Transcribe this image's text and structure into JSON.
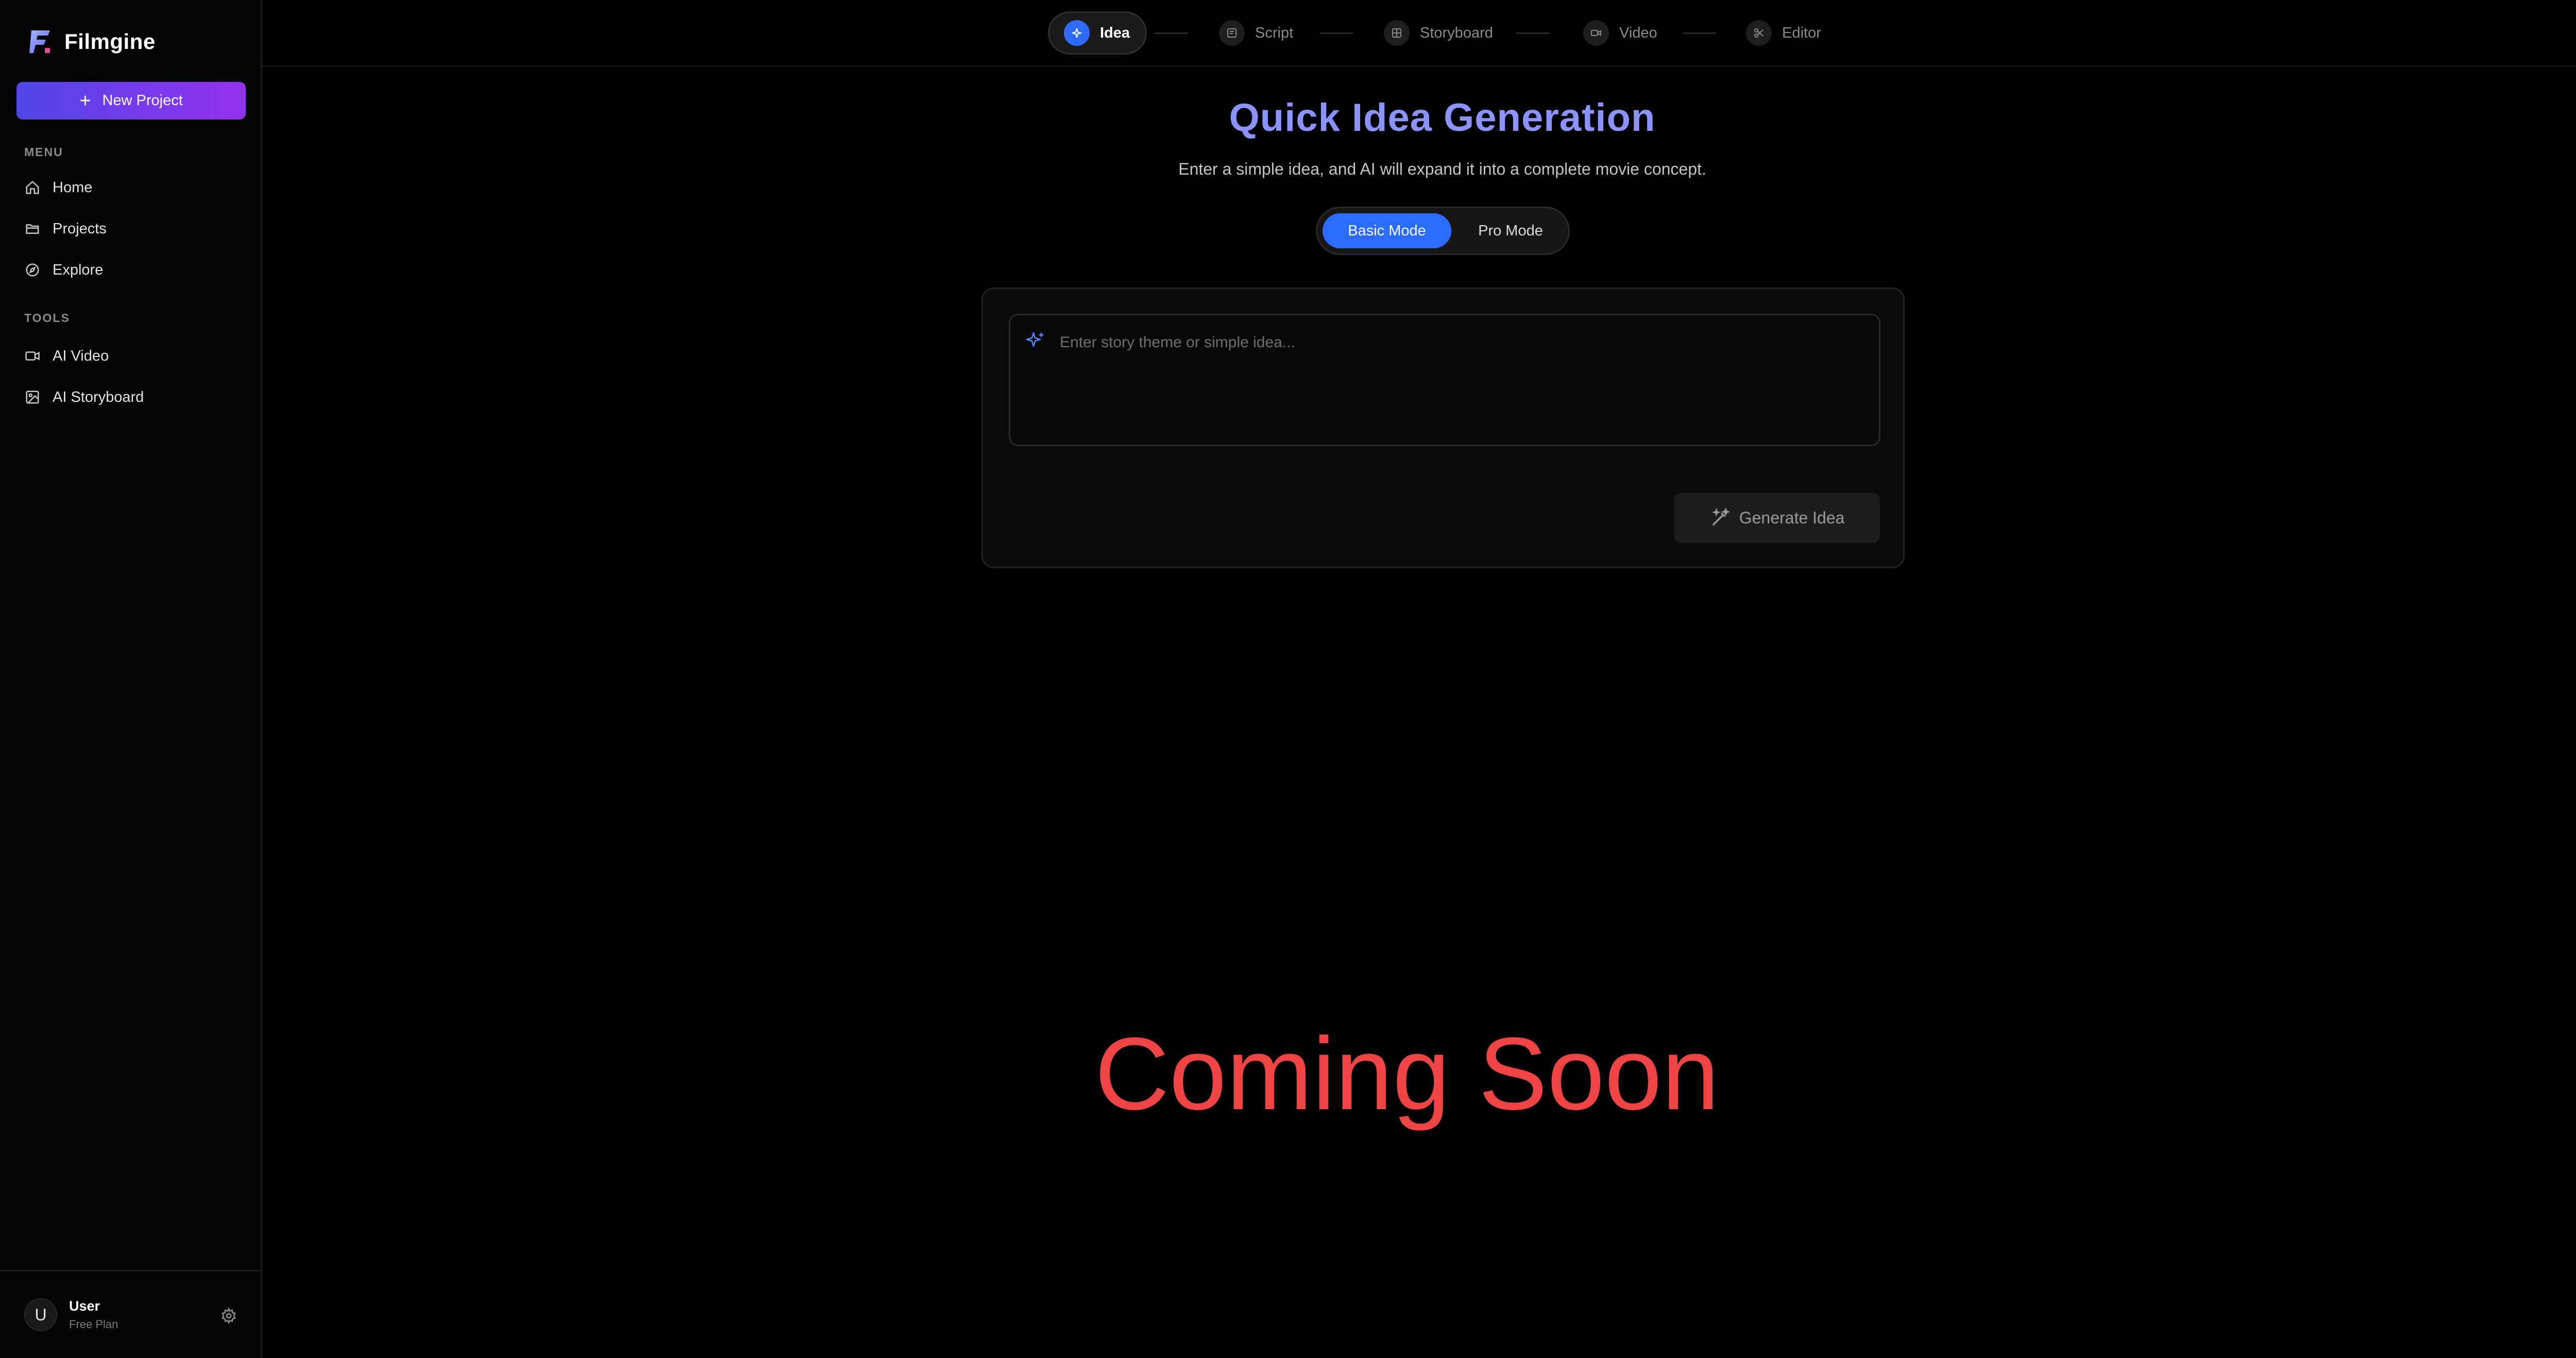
{
  "app": {
    "name": "Filmgine",
    "accent_gradient": [
      "#4f46e5",
      "#9333ea"
    ]
  },
  "sidebar": {
    "new_project_label": "New Project",
    "menu_title": "MENU",
    "menu_items": [
      {
        "label": "Home",
        "icon": "home-icon"
      },
      {
        "label": "Projects",
        "icon": "folder-icon"
      },
      {
        "label": "Explore",
        "icon": "compass-icon"
      }
    ],
    "tools_title": "TOOLS",
    "tool_items": [
      {
        "label": "AI Video",
        "icon": "video-icon"
      },
      {
        "label": "AI Storyboard",
        "icon": "image-icon"
      }
    ],
    "user": {
      "initial": "U",
      "name": "User",
      "plan": "Free Plan"
    }
  },
  "stepper": {
    "active_color": "#2f6bff",
    "steps": [
      {
        "label": "Idea",
        "icon": "sparkle-icon",
        "active": true
      },
      {
        "label": "Script",
        "icon": "script-icon",
        "active": false
      },
      {
        "label": "Storyboard",
        "icon": "storyboard-icon",
        "active": false
      },
      {
        "label": "Video",
        "icon": "video-icon",
        "active": false
      },
      {
        "label": "Editor",
        "icon": "editor-icon",
        "active": false
      }
    ]
  },
  "main": {
    "title": "Quick Idea Generation",
    "subtitle": "Enter a simple idea, and AI will expand it into a complete movie concept.",
    "modes": {
      "basic": "Basic Mode",
      "pro": "Pro Mode",
      "selected": "Basic Mode"
    },
    "idea_input": {
      "value": "",
      "placeholder": "Enter story theme or simple idea..."
    },
    "generate_label": "Generate Idea",
    "coming_soon": "Coming Soon",
    "coming_soon_color": "#ef4444"
  }
}
